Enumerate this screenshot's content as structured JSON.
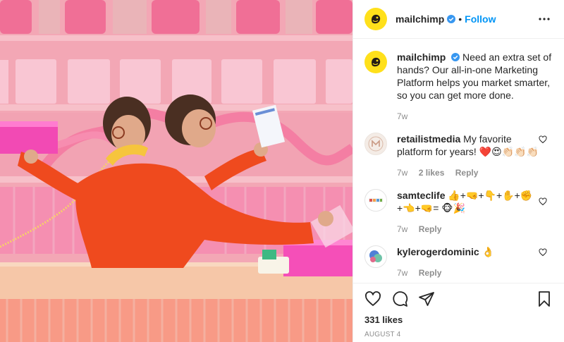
{
  "header": {
    "username": "mailchimp",
    "separator": "•",
    "follow_label": "Follow"
  },
  "caption": {
    "username": "mailchimp",
    "text": "Need an extra set of hands? Our all-in-one Marketing Platform helps you market smarter, so you can get more done.",
    "time": "7w"
  },
  "comments": [
    {
      "username": "retailistmedia",
      "text": "My favorite platform for years! ❤️😍👏🏻👏🏻👏🏻",
      "time": "7w",
      "likes": "2 likes",
      "reply": "Reply"
    },
    {
      "username": "samteclife",
      "text": "👍+🤜+👇+✋+✊+👈+🤜= 🐵🎉",
      "time": "7w",
      "reply": "Reply"
    },
    {
      "username": "kylerogerdominic",
      "text": "👌",
      "time": "7w",
      "reply": "Reply"
    }
  ],
  "likes_count": "331 likes",
  "date": "AUGUST 4",
  "icons": {
    "like": "heart-icon",
    "comment": "comment-icon",
    "share": "paper-plane-icon",
    "save": "bookmark-icon",
    "more": "more-options-icon",
    "verified": "verified-badge-icon"
  },
  "colors": {
    "follow": "#0095f6",
    "verified": "#3897f0",
    "brand_yellow": "#ffe01b",
    "photo_pink": "#f2a9b6",
    "sweater_orange": "#ef4a1e"
  }
}
